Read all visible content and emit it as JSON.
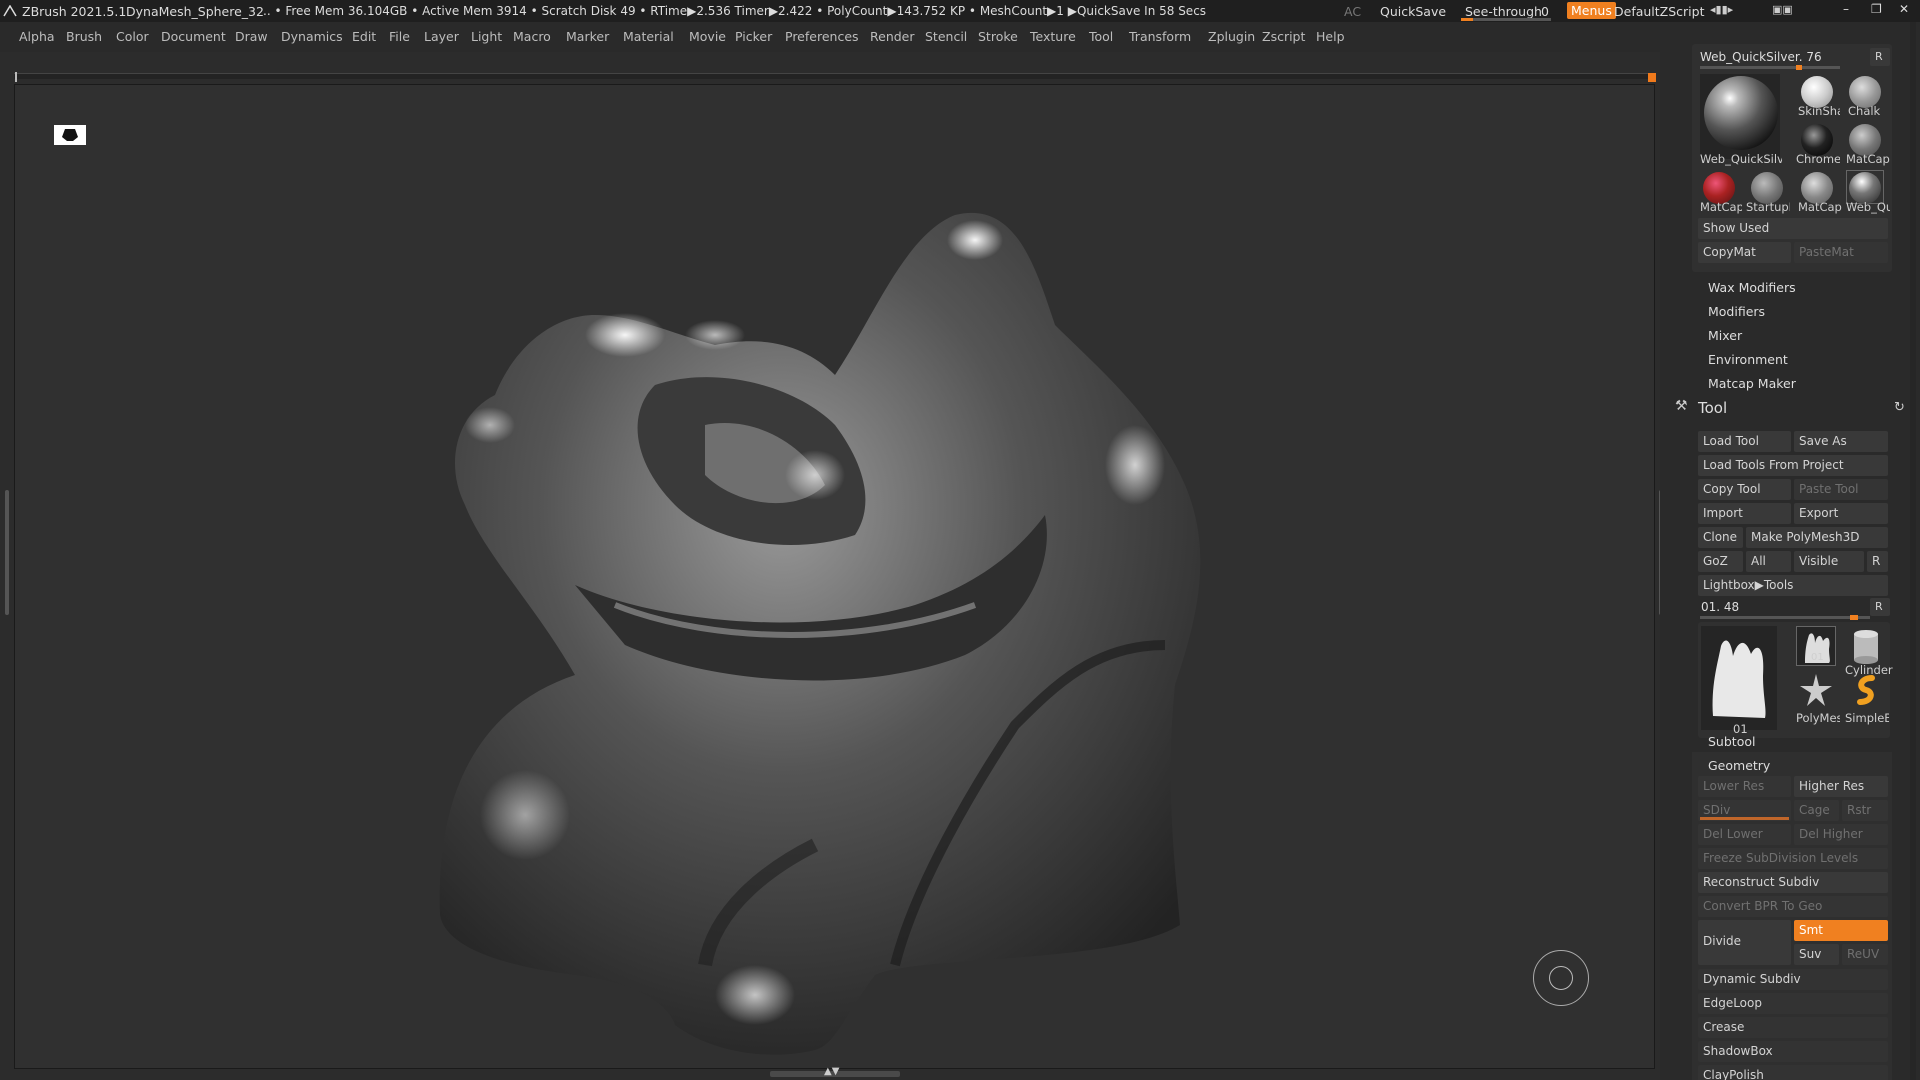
{
  "titlebar": {
    "app": "ZBrush 2021.5.1",
    "doc": "DynaMesh_Sphere_32",
    "stats": ".. • Free Mem 36.104GB • Active Mem 3914 • Scratch Disk 49 • RTime▶2.536 Timer▶2.422 • PolyCount▶143.752 KP • MeshCount▶1 ▶QuickSave In 58 Secs",
    "ac": "AC",
    "quicksave": "QuickSave",
    "seethrough": "See-through",
    "seethrough_value": "0",
    "menus": "Menus",
    "script": "DefaultZScript"
  },
  "menu": [
    "Alpha",
    "Brush",
    "Color",
    "Document",
    "Draw",
    "Dynamics",
    "Edit",
    "File",
    "Layer",
    "Light",
    "Macro",
    "Marker",
    "Material",
    "Movie",
    "Picker",
    "Preferences",
    "Render",
    "Stencil",
    "Stroke",
    "Texture",
    "Tool",
    "Transform",
    "Zplugin",
    "Zscript",
    "Help"
  ],
  "material": {
    "current": "Web_QuickSilver. 76",
    "r": "R",
    "big_label": "Web_QuickSilver",
    "swatches": [
      "SkinSha",
      "Chalk",
      "Chrome",
      "MatCap",
      "MatCap",
      "StartupM",
      "MatCap",
      "Web_Qu"
    ],
    "show_used": "Show Used",
    "copy": "CopyMat",
    "paste": "PasteMat",
    "sections": [
      "Wax Modifiers",
      "Modifiers",
      "Mixer",
      "Environment",
      "Matcap Maker"
    ]
  },
  "tool": {
    "title": "Tool",
    "load": "Load Tool",
    "save_as": "Save As",
    "load_project": "Load Tools From Project",
    "copy": "Copy Tool",
    "paste": "Paste Tool",
    "import": "Import",
    "export": "Export",
    "clone": "Clone",
    "make_poly": "Make PolyMesh3D",
    "goz": "GoZ",
    "all": "All",
    "visible": "Visible",
    "r": "R",
    "lightbox": "Lightbox▶Tools",
    "current": "01. 48",
    "thumb_label": "01",
    "small_thumbs": [
      "01",
      "Cylinder",
      "PolyMes",
      "SimpleB"
    ]
  },
  "subtool": "Subtool",
  "geometry": {
    "title": "Geometry",
    "lower_res": "Lower Res",
    "higher_res": "Higher Res",
    "sdiv": "SDiv",
    "cage": "Cage",
    "rstr": "Rstr",
    "del_lower": "Del Lower",
    "del_higher": "Del Higher",
    "freeze": "Freeze SubDivision Levels",
    "reconstruct": "Reconstruct Subdiv",
    "convert": "Convert BPR To Geo",
    "divide": "Divide",
    "smt": "Smt",
    "suv": "Suv",
    "reuv": "ReUV",
    "sections": [
      "Dynamic Subdiv",
      "EdgeLoop",
      "Crease",
      "ShadowBox",
      "ClayPolish"
    ]
  },
  "colors": {
    "accent": "#f08020",
    "bg": "#2b2b2b",
    "panel": "#2a2a2a"
  }
}
